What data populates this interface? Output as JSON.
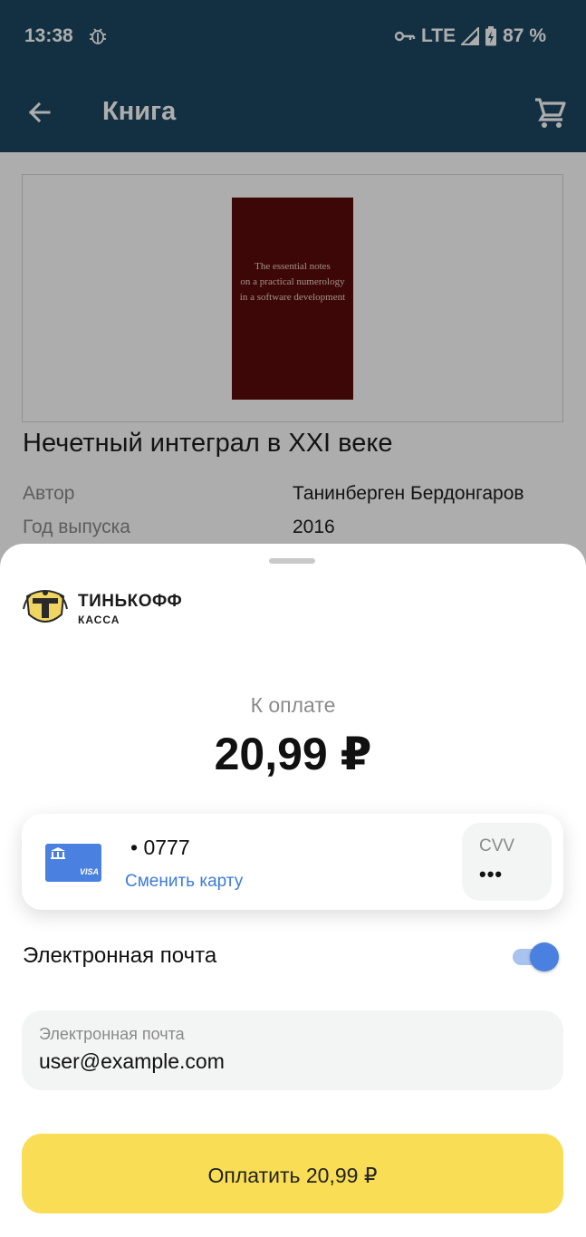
{
  "status_bar": {
    "time": "13:38",
    "network": "LTE",
    "battery": "87 %",
    "icons": [
      "debug-icon",
      "vpn-key-icon",
      "signal-icon",
      "battery-charging-icon"
    ]
  },
  "app_bar": {
    "title": "Книга",
    "back_icon": "arrow-left-icon",
    "cart_icon": "cart-icon"
  },
  "book": {
    "cover_text": [
      "The essential notes",
      "on a practical numerology",
      "in a software development"
    ],
    "title": "Нечетный интеграл в XXI веке",
    "meta": [
      {
        "label": "Автор",
        "value": "Танинберген Бердонгаров"
      },
      {
        "label": "Год выпуска",
        "value": "2016"
      }
    ]
  },
  "payment_sheet": {
    "brand": "ТИНЬКОФФ",
    "brand_sub": "КАССА",
    "pay_label": "К оплате",
    "amount": "20,99 ₽",
    "card": {
      "number": "• 0777",
      "change_label": "Сменить карту",
      "cvv_label": "CVV",
      "cvv_value": "•••",
      "brand": "VISA"
    },
    "email_toggle": {
      "label": "Электронная почта",
      "on": true
    },
    "email_field": {
      "label": "Электронная почта",
      "value": "user@example.com"
    },
    "pay_button": "Оплатить 20,99 ₽"
  },
  "colors": {
    "app_bar": "#1d4862",
    "link": "#3c7bdc",
    "pay_button": "#f8dd55",
    "toggle": "#4a80e0",
    "card_icon": "#4a80e0"
  }
}
